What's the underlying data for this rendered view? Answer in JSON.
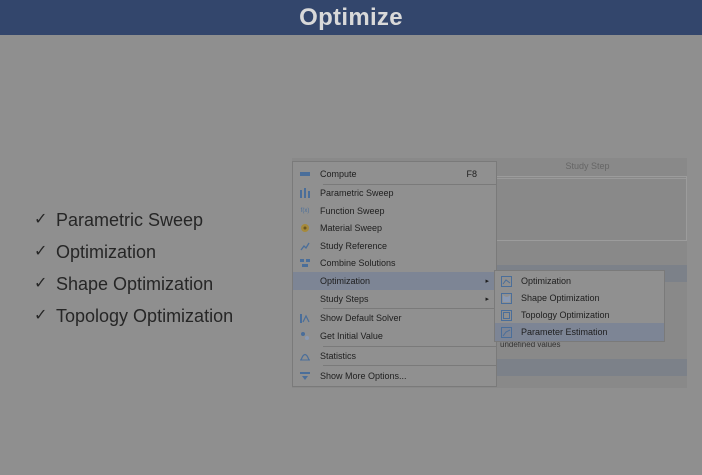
{
  "header": {
    "title": "Optimize"
  },
  "bullets": [
    {
      "check": "✓",
      "text": "Parametric Sweep"
    },
    {
      "check": "✓",
      "text": "Optimization"
    },
    {
      "check": "✓",
      "text": "Shape Optimization"
    },
    {
      "check": "✓",
      "text": "Topology Optimization"
    }
  ],
  "background_panel": {
    "column_header": "Study Step",
    "note_text": "undefined values"
  },
  "menu": {
    "items": [
      {
        "label": "Compute",
        "shortcut": "F8",
        "icon": "compute-icon"
      },
      {
        "label": "Parametric Sweep",
        "icon": "parametric-sweep-icon"
      },
      {
        "label": "Function Sweep",
        "icon": "function-sweep-icon",
        "icon_text": "f(x)"
      },
      {
        "label": "Material Sweep",
        "icon": "material-sweep-icon"
      },
      {
        "label": "Study Reference",
        "icon": "study-reference-icon"
      },
      {
        "label": "Combine Solutions",
        "icon": "combine-solutions-icon"
      },
      {
        "label": "Optimization",
        "arrow": "▸"
      },
      {
        "label": "Study Steps",
        "arrow": "▸"
      },
      {
        "label": "Show Default Solver",
        "icon": "show-default-solver-icon"
      },
      {
        "label": "Get Initial Value",
        "icon": "get-initial-value-icon"
      },
      {
        "label": "Statistics",
        "icon": "statistics-icon"
      },
      {
        "label": "Show More Options...",
        "icon": "show-more-options-icon"
      }
    ]
  },
  "submenu": {
    "items": [
      {
        "label": "Optimization",
        "icon": "optimization-icon"
      },
      {
        "label": "Shape Optimization",
        "icon": "shape-optimization-icon"
      },
      {
        "label": "Topology Optimization",
        "icon": "topology-optimization-icon"
      },
      {
        "label": "Parameter Estimation",
        "icon": "parameter-estimation-icon"
      }
    ]
  },
  "colors": {
    "title_bar": "#33466c",
    "highlight": "#7d8595"
  }
}
